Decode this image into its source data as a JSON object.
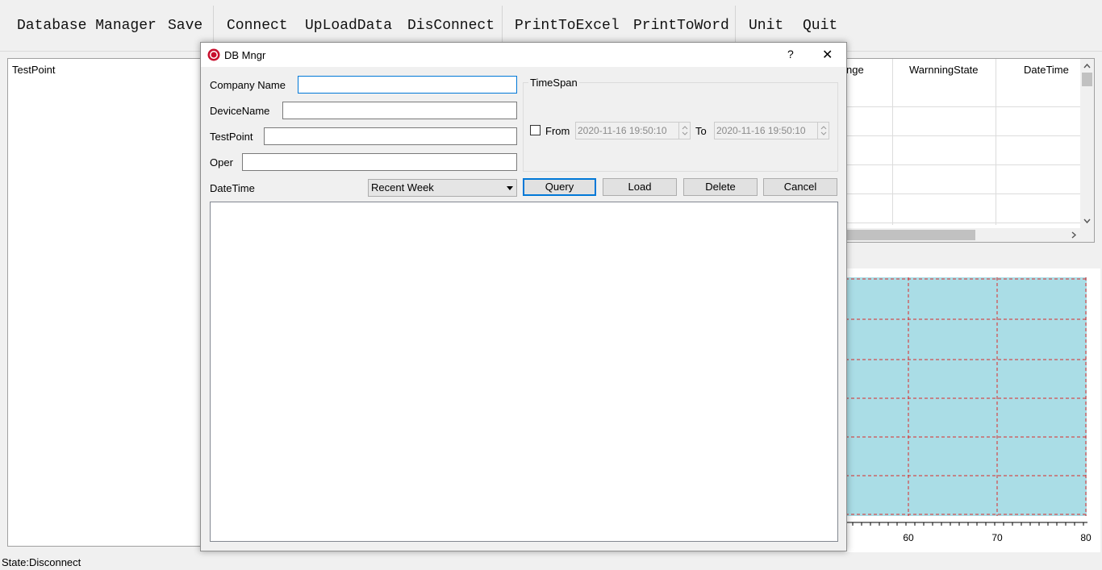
{
  "toolbar": {
    "items": [
      "Database Manager",
      "Save",
      "Connect",
      "UpLoadData",
      "DisConnect",
      "PrintToExcel",
      "PrintToWord",
      "Unit",
      "Quit"
    ]
  },
  "left_panel": {
    "header": "TestPoint"
  },
  "grid": {
    "columns": [
      "nge",
      "WarnningState",
      "DateTime"
    ]
  },
  "chart": {
    "background": "#aadde6",
    "grid_color": "#d92a2a",
    "x_ticks": [
      "60",
      "70",
      "80"
    ]
  },
  "dialog": {
    "title": "DB Mngr",
    "help": "?",
    "close": "✕",
    "company_label": "Company Name",
    "company_value": "",
    "device_label": "DeviceName",
    "device_value": "",
    "testpoint_label": "TestPoint",
    "testpoint_value": "",
    "oper_label": "Oper",
    "oper_value": "",
    "timespan_label": "TimeSpan",
    "from_label": "From",
    "from_value": "2020-11-16 19:50:10",
    "to_label": "To",
    "to_value": "2020-11-16 19:50:10",
    "datetime_label": "DateTime",
    "datetime_selected": "Recent Week",
    "query": "Query",
    "load": "Load",
    "delete": "Delete",
    "cancel": "Cancel"
  },
  "status": "State:Disconnect"
}
